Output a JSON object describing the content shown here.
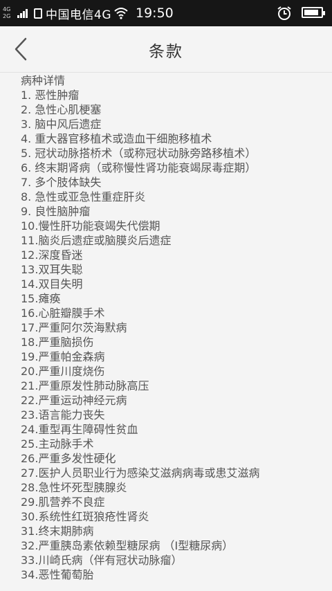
{
  "status_bar": {
    "net_top": "4G",
    "net_bottom": "2G",
    "carrier": "中国电信4G",
    "time": "19:50",
    "icons": [
      "signal-icon",
      "sim-icon",
      "wifi-icon",
      "alarm-icon",
      "battery-icon"
    ]
  },
  "nav": {
    "title": "条款",
    "back_icon": "chevron-left-icon"
  },
  "content": {
    "heading": "病种详情",
    "items": [
      "1. 恶性肿瘤",
      "2. 急性心肌梗塞",
      "3. 脑中风后遗症",
      "4. 重大器官移植术或造血干细胞移植术",
      "5. 冠状动脉搭桥术（或称冠状动脉旁路移植术）",
      "6. 终末期肾病（或称慢性肾功能衰竭尿毒症期）",
      "7. 多个肢体缺失",
      "8. 急性或亚急性重症肝炎",
      "9. 良性脑肿瘤",
      "10.慢性肝功能衰竭失代偿期",
      "11.脑炎后遗症或脑膜炎后遗症",
      "12.深度昏迷",
      "13.双耳失聪",
      "14.双目失明",
      "15.瘫痪",
      "16.心脏瓣膜手术",
      "17.严重阿尔茨海默病",
      "18.严重脑损伤",
      "19.严重帕金森病",
      "20.严重川度烧伤",
      "21.严重原发性肺动脉高压",
      "22.严重运动神经元病",
      "23.语言能力丧失",
      "24.重型再生障碍性贫血",
      "25.主动脉手术",
      "26.严重多发性硬化",
      "27.医护人员职业行为感染艾滋病病毒或患艾滋病",
      "28.急性坏死型胰腺炎",
      "29.肌营养不良症",
      "30.系统性红斑狼疮性肾炎",
      "31.终末期肺病",
      "32.严重胰岛素依赖型糖尿病 （I型糖尿病）",
      "33.川崎氏病（伴有冠状动脉瘤）",
      "34.恶性葡萄胎"
    ]
  }
}
